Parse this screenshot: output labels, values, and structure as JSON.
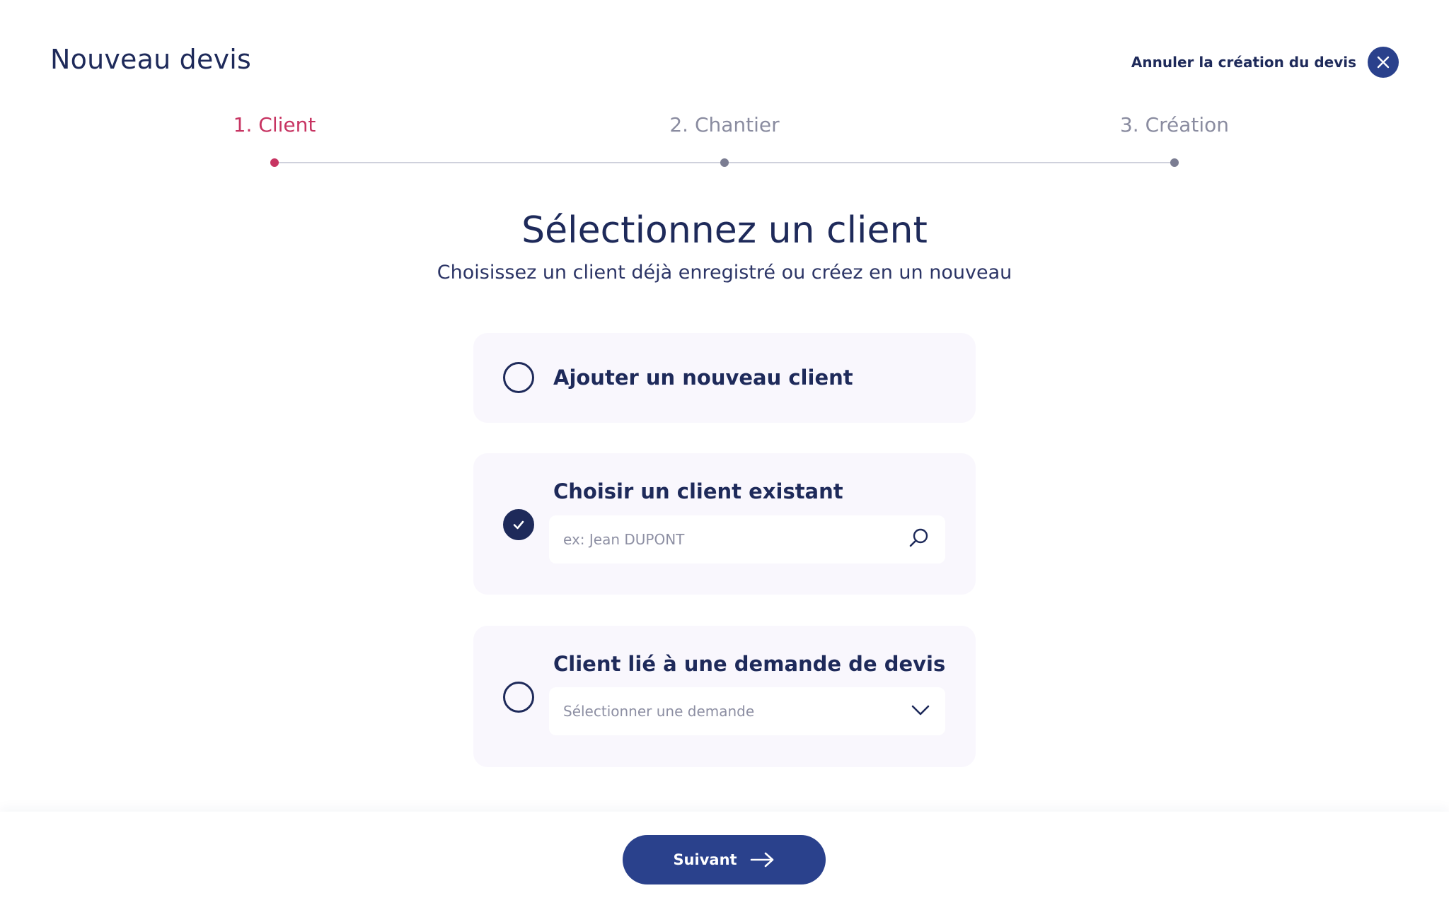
{
  "header": {
    "title": "Nouveau devis",
    "cancel_label": "Annuler la création du devis",
    "cancel_icon": "close-icon"
  },
  "stepper": {
    "steps": [
      {
        "label": "1. Client",
        "state": "active"
      },
      {
        "label": "2. Chantier",
        "state": "pending"
      },
      {
        "label": "3. Création",
        "state": "pending"
      }
    ]
  },
  "main": {
    "heading": "Sélectionnez un client",
    "subheading": "Choisissez un client déjà enregistré ou créez en un nouveau",
    "options": [
      {
        "title": "Ajouter un nouveau client",
        "selected": false
      },
      {
        "title": "Choisir un client existant",
        "selected": true,
        "input_placeholder": "ex: Jean DUPONT",
        "input_value": "",
        "icon": "search-icon"
      },
      {
        "title": "Client lié à une demande de devis",
        "selected": false,
        "select_value": "Sélectionner une demande",
        "icon": "chevron-down-icon"
      }
    ]
  },
  "footer": {
    "next_label": "Suivant",
    "next_icon": "arrow-right-icon"
  },
  "colors": {
    "primary": "#2a418c",
    "text": "#1e2a5a",
    "accent": "#c73462",
    "card_bg": "#f9f7fd"
  }
}
